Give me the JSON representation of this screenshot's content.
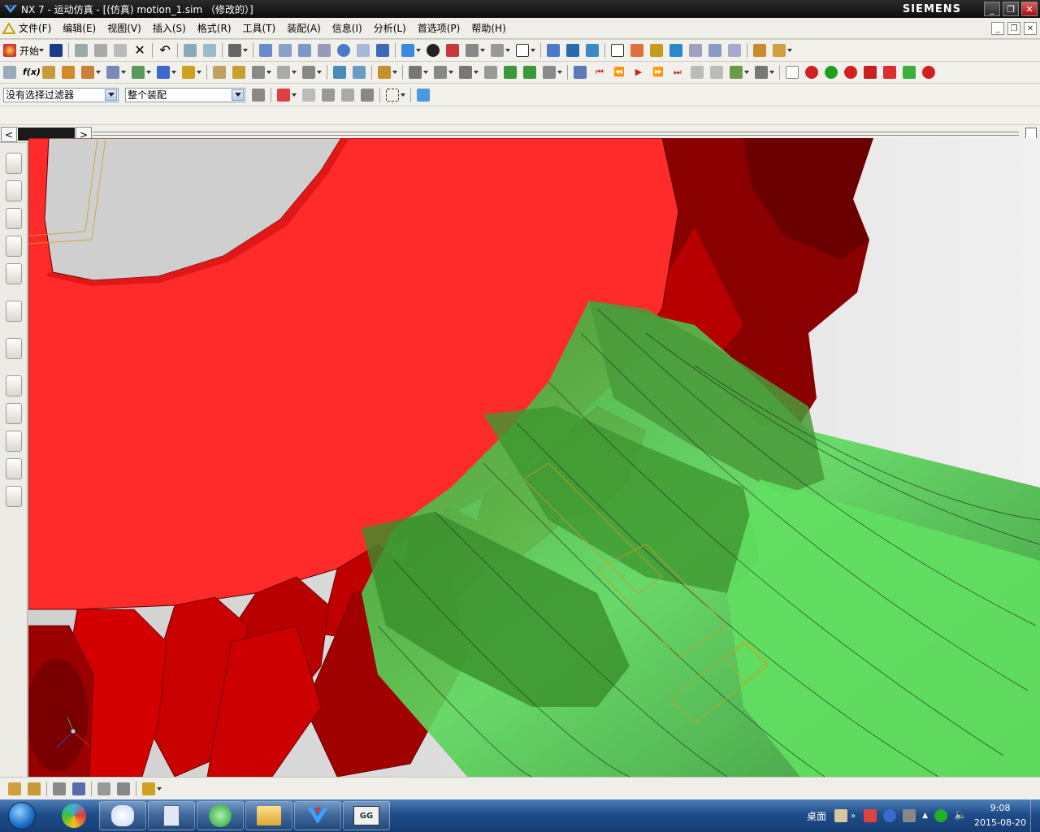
{
  "window": {
    "title": "NX 7 - 运动仿真 - [(仿真) motion_1.sim （修改的）]",
    "brand": "SIEMENS"
  },
  "menu": {
    "items": [
      "文件(F)",
      "编辑(E)",
      "视图(V)",
      "插入(S)",
      "格式(R)",
      "工具(T)",
      "装配(A)",
      "信息(I)",
      "分析(L)",
      "首选项(P)",
      "帮助(H)"
    ]
  },
  "toolbar": {
    "start_label": "开始"
  },
  "selection_bar": {
    "filter_value": "没有选择过滤器",
    "scope_value": "整个装配"
  },
  "taskbar": {
    "desktop_label": "桌面",
    "clock_time": "9:08",
    "clock_date": "2015-08-20"
  },
  "colors": {
    "gear_red": "#ff2a2a",
    "shaft_green": "#55e055",
    "viewport_bg": "#e2e2e2"
  }
}
